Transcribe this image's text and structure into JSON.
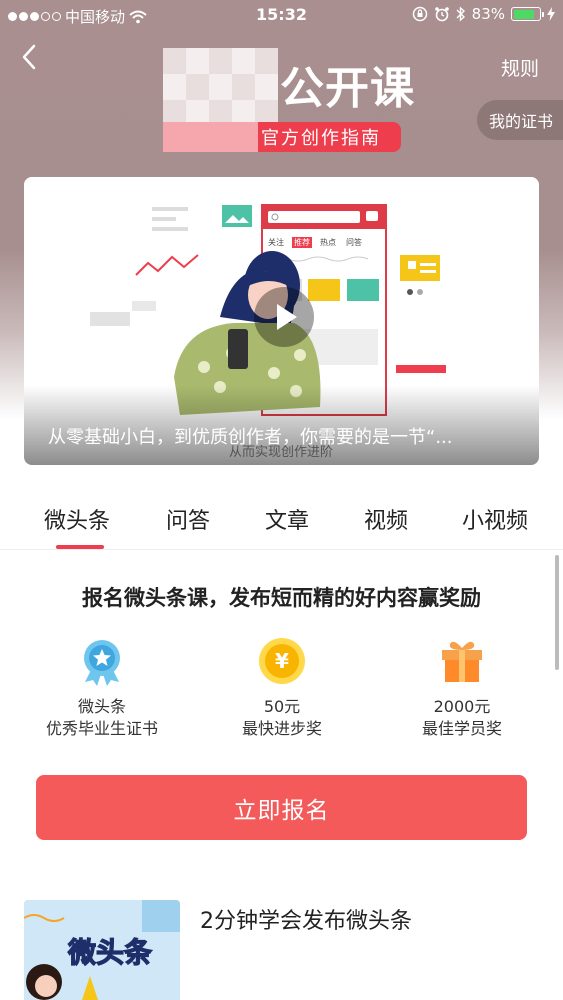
{
  "status_bar": {
    "carrier": "中国移动",
    "time": "15:32",
    "battery": "83%",
    "battery_level": 0.83
  },
  "nav": {
    "rules_label": "规则",
    "my_certificate_label": "我的证书"
  },
  "banner": {
    "title_visible": "公开课",
    "subtitle_visible": "官方创作指南"
  },
  "video": {
    "caption": "从零基础小白，到优质创作者，你需要的是一节“...",
    "overlay_text": "从而实现创作进阶",
    "illustration_tabs": [
      "关注",
      "推荐",
      "热点",
      "问答"
    ]
  },
  "tabs": [
    {
      "label": "微头条",
      "active": true
    },
    {
      "label": "问答",
      "active": false
    },
    {
      "label": "文章",
      "active": false
    },
    {
      "label": "视频",
      "active": false
    },
    {
      "label": "小视频",
      "active": false
    }
  ],
  "promo": {
    "headline": "报名微头条课，发布短而精的好内容赢奖励",
    "rewards": [
      {
        "icon": "medal-icon",
        "line1": "微头条",
        "line2": "优秀毕业生证书"
      },
      {
        "icon": "yuan-coin-icon",
        "line1": "50元",
        "line2": "最快进步奖"
      },
      {
        "icon": "gift-icon",
        "line1": "2000元",
        "line2": "最佳学员奖"
      }
    ],
    "signup_label": "立即报名"
  },
  "course": {
    "title": "2分钟学会发布微头条",
    "thumb_text": "微头条"
  },
  "colors": {
    "accent_red": "#ee3d4c",
    "button_red": "#f45a5a",
    "header_bg": "#a98f8f"
  }
}
